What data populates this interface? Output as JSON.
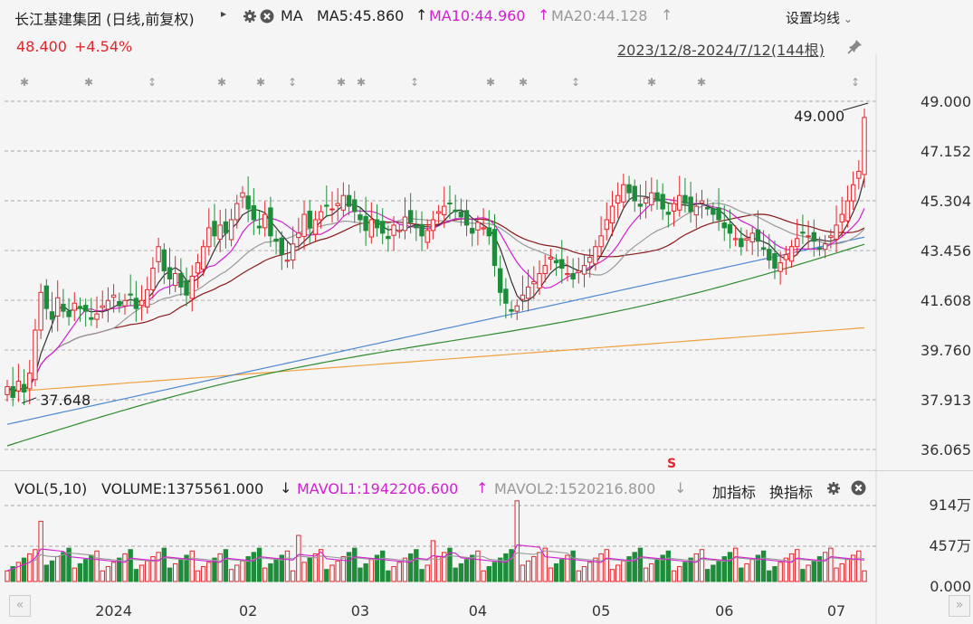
{
  "header": {
    "stock_name": "长江基建集团 (日线,前复权)",
    "play_icon": "▸",
    "ma_label": "MA",
    "ma5": "MA5:45.860",
    "ma10": "MA10:44.960",
    "ma20": "MA20:44.128",
    "settings": "设置均线",
    "price": "48.400",
    "change": "+4.54%",
    "range": "2023/12/8-2024/7/12(144根)"
  },
  "volume_header": {
    "vol": "VOL(5,10)",
    "volume": "VOLUME:1375561.000",
    "mavol1": "MAVOL1:1942206.600",
    "mavol2": "MAVOL2:1520216.800",
    "add_indicator": "加指标",
    "switch_indicator": "换指标"
  },
  "chart_data": {
    "type": "candlestick",
    "price_axis": [
      "49.000",
      "47.152",
      "45.304",
      "43.456",
      "41.608",
      "39.760",
      "37.913",
      "36.065"
    ],
    "ylim": [
      35.8,
      49.6
    ],
    "volume_axis": [
      "914万",
      "457万",
      "0.000"
    ],
    "volume_max": 10000000,
    "x_ticks": [
      {
        "label": "2024",
        "index": 19
      },
      {
        "label": "02",
        "index": 43
      },
      {
        "label": "03",
        "index": 63
      },
      {
        "label": "04",
        "index": 84
      },
      {
        "label": "05",
        "index": 106
      },
      {
        "label": "06",
        "index": 128
      },
      {
        "label": "07",
        "index": 148
      }
    ],
    "annotations": [
      {
        "label": "49.000",
        "type": "high",
        "index": 154,
        "value": 49.0
      },
      {
        "label": "37.648",
        "type": "low",
        "index": 1,
        "value": 37.65
      }
    ],
    "ohlc_close": [
      38.4,
      38.0,
      38.6,
      38.2,
      38.9,
      40.5,
      41.9,
      41.3,
      40.9,
      41.7,
      41.2,
      41.0,
      41.5,
      41.3,
      41.2,
      40.9,
      41.1,
      41.4,
      41.6,
      41.8,
      41.4,
      41.6,
      41.8,
      41.3,
      41.6,
      42.0,
      42.8,
      43.6,
      42.7,
      42.4,
      42.6,
      42.1,
      41.8,
      42.5,
      43.0,
      43.6,
      44.3,
      44.0,
      44.4,
      44.1,
      44.6,
      45.2,
      45.6,
      45.0,
      44.6,
      44.3,
      44.8,
      44.0,
      43.8,
      43.3,
      43.1,
      43.7,
      44.1,
      44.8,
      44.3,
      44.6,
      44.9,
      45.1,
      45.0,
      45.2,
      45.5,
      45.1,
      44.9,
      44.6,
      44.2,
      44.6,
      44.3,
      44.1,
      43.9,
      44.4,
      44.2,
      44.7,
      44.5,
      44.3,
      44.0,
      44.2,
      44.6,
      44.9,
      45.1,
      45.2,
      44.9,
      44.7,
      44.4,
      44.1,
      44.5,
      44.3,
      44.0,
      42.9,
      41.9,
      41.5,
      41.2,
      41.4,
      41.8,
      42.1,
      42.3,
      42.6,
      42.9,
      43.2,
      43.0,
      42.8,
      42.6,
      42.4,
      42.7,
      42.9,
      43.2,
      43.6,
      44.0,
      44.6,
      45.1,
      45.5,
      45.9,
      45.6,
      45.3,
      45.1,
      45.4,
      45.6,
      45.3,
      45.0,
      44.8,
      45.2,
      45.5,
      45.2,
      44.9,
      45.1,
      45.3,
      45.0,
      44.8,
      44.6,
      44.3,
      44.1,
      43.9,
      43.6,
      43.9,
      44.1,
      43.8,
      43.5,
      43.1,
      42.8,
      43.0,
      43.3,
      43.6,
      43.9,
      44.1,
      44.0,
      43.8,
      43.5,
      43.7,
      44.0,
      44.4,
      44.8,
      45.3,
      45.9,
      46.4,
      48.4
    ]
  }
}
